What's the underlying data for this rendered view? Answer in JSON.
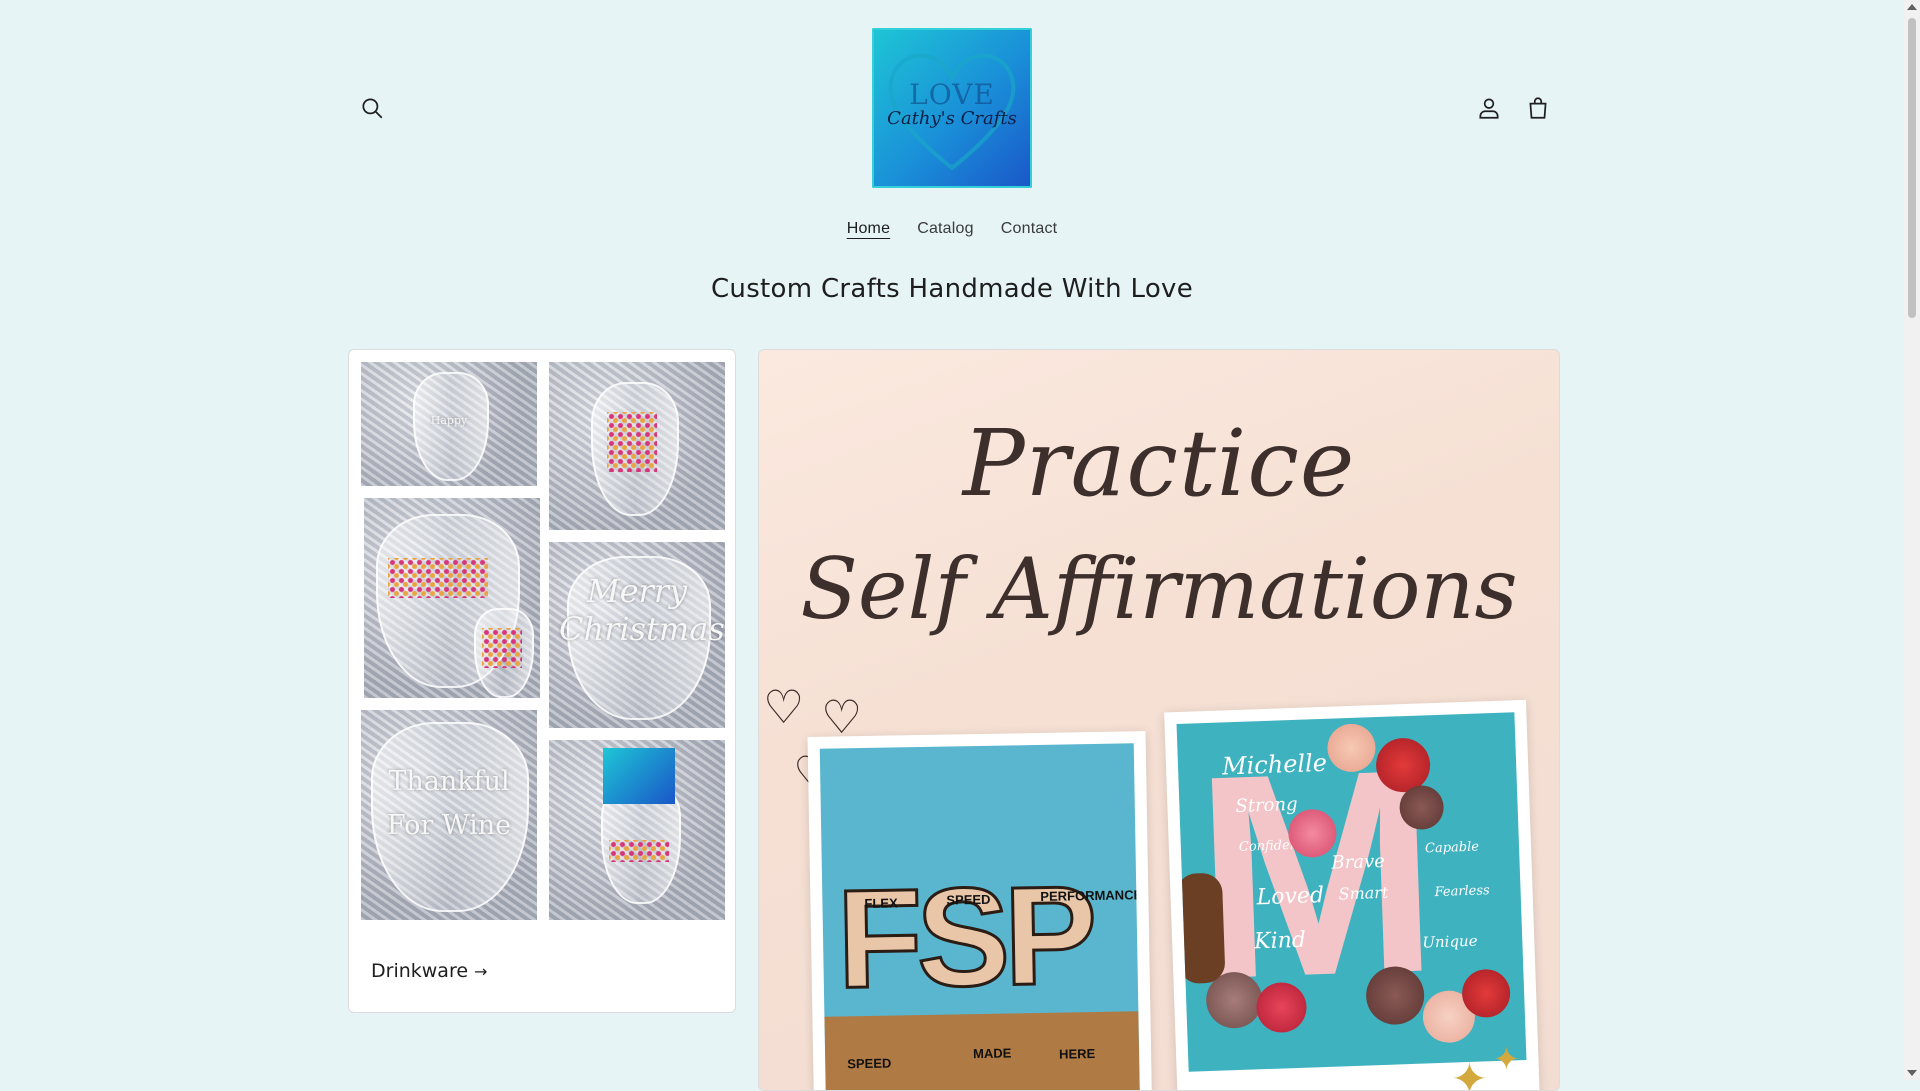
{
  "header": {
    "logo": {
      "top_text": "LOVE",
      "name": "Cathy's Crafts"
    },
    "icons": {
      "search": "search-icon",
      "account": "account-icon",
      "cart": "cart-icon"
    }
  },
  "nav": {
    "items": [
      "Home",
      "Catalog",
      "Contact"
    ],
    "active": "Home"
  },
  "hero": {
    "headline": "Custom Crafts Handmade With Love"
  },
  "collection_card": {
    "link_label": "Drinkware",
    "tiles": [
      {
        "text": "Happy"
      },
      {
        "text": ""
      },
      {
        "text": ""
      },
      {
        "text": "Merry Christmas"
      },
      {
        "text": "Thankful For Wine"
      },
      {
        "text": ""
      }
    ]
  },
  "promo": {
    "title_line1": "Practice",
    "title_line2": "Self Affirmations",
    "fsp": {
      "letters": "FSP",
      "labels": [
        "FLEX",
        "SPEED",
        "PERFORMANCE",
        "MADE",
        "HERE",
        "SPEED"
      ]
    },
    "monogram": {
      "letter": "M",
      "words": [
        "Michelle",
        "Strong",
        "Confident",
        "Brave",
        "Smart",
        "Loved",
        "Kind",
        "Capable",
        "Fearless",
        "Unique"
      ]
    }
  },
  "colors": {
    "background": "#e6f4f6",
    "text": "#1e1e1e",
    "logo_gradient_start": "#1ec6d6",
    "logo_gradient_end": "#1a56c8"
  }
}
